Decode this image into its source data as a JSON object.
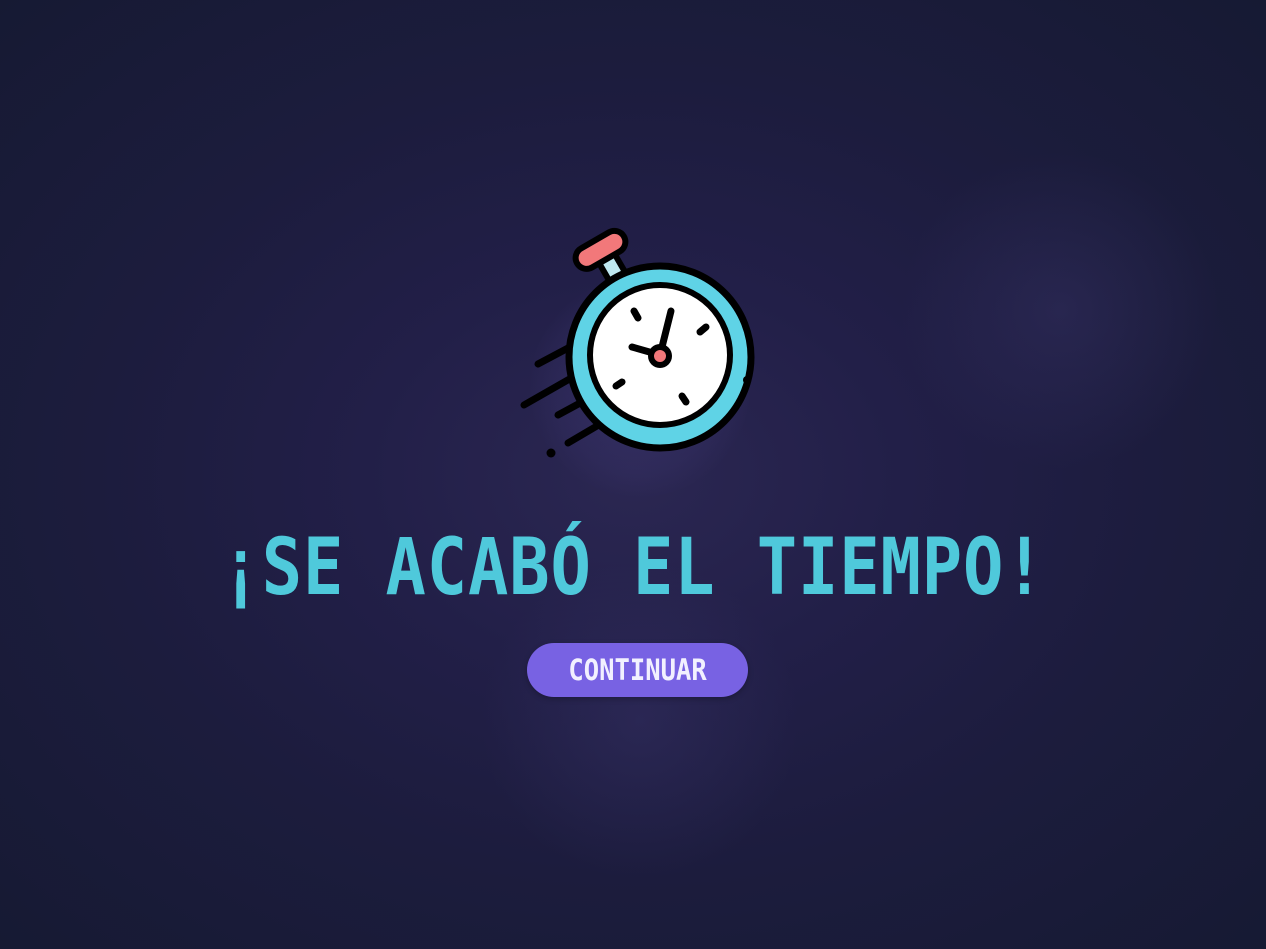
{
  "screen": {
    "title": "¡SE ACABÓ EL TIEMPO!",
    "continue_label": "CONTINUAR",
    "icon": "stopwatch-icon"
  },
  "colors": {
    "background": "#1c1c3d",
    "title": "#4fc9db",
    "button": "#7862e3",
    "button_text": "#f2f0ff",
    "stopwatch_ring": "#5fd3e6",
    "stopwatch_button": "#f2787a"
  }
}
